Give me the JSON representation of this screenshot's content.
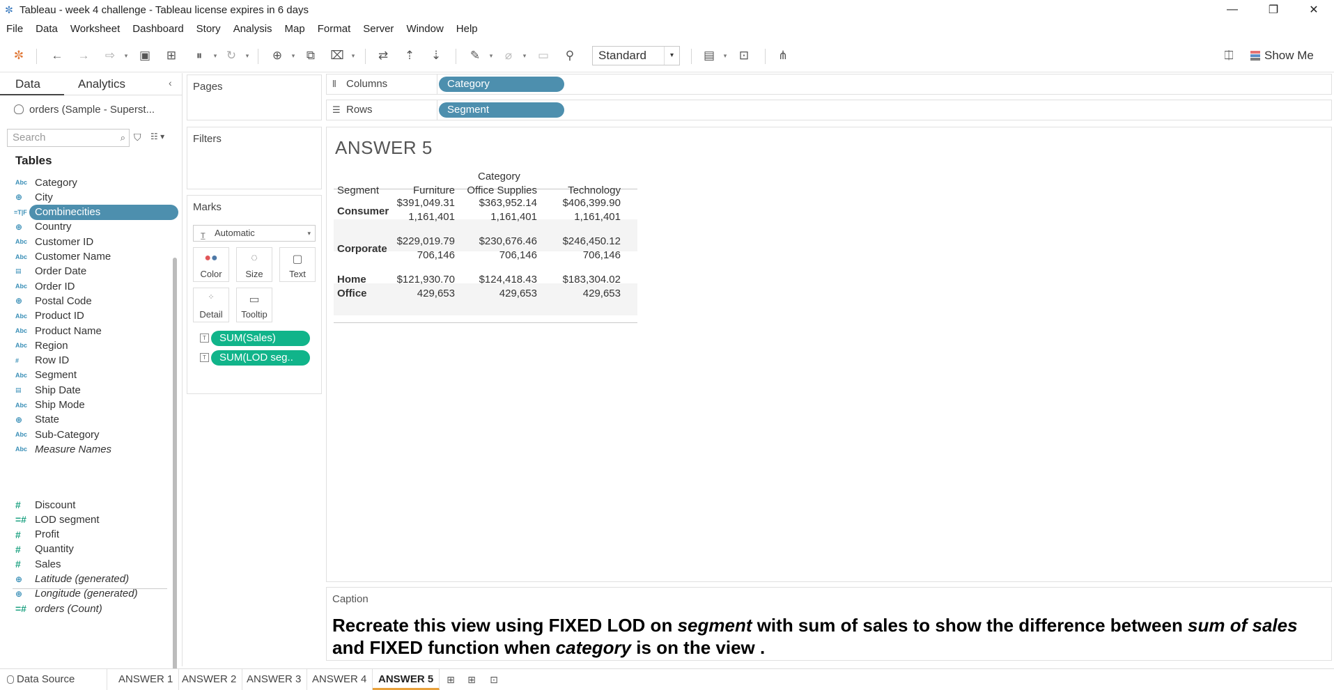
{
  "window": {
    "title": "Tableau - week 4 challenge - Tableau license expires in 6 days",
    "minimize": "—",
    "restore": "❐",
    "close": "✕"
  },
  "menu": [
    "File",
    "Data",
    "Worksheet",
    "Dashboard",
    "Story",
    "Analysis",
    "Map",
    "Format",
    "Server",
    "Window",
    "Help"
  ],
  "toolbar": {
    "fit_value": "Standard",
    "show_me_label": "Show Me"
  },
  "data_pane": {
    "tab_data": "Data",
    "tab_analytics": "Analytics",
    "datasource": "orders (Sample - Superst...",
    "search_placeholder": "Search",
    "tables_heading": "Tables",
    "dimensions": [
      {
        "name": "Category",
        "icon": "Abc"
      },
      {
        "name": "City",
        "icon": "geo"
      },
      {
        "name": "Combinecities",
        "icon": "combo",
        "selected": true
      },
      {
        "name": "Country",
        "icon": "geo"
      },
      {
        "name": "Customer ID",
        "icon": "Abc"
      },
      {
        "name": "Customer Name",
        "icon": "Abc"
      },
      {
        "name": "Order Date",
        "icon": "date"
      },
      {
        "name": "Order ID",
        "icon": "Abc"
      },
      {
        "name": "Postal Code",
        "icon": "geo"
      },
      {
        "name": "Product ID",
        "icon": "Abc"
      },
      {
        "name": "Product Name",
        "icon": "Abc"
      },
      {
        "name": "Region",
        "icon": "Abc"
      },
      {
        "name": "Row ID",
        "icon": "#"
      },
      {
        "name": "Segment",
        "icon": "Abc"
      },
      {
        "name": "Ship Date",
        "icon": "date"
      },
      {
        "name": "Ship Mode",
        "icon": "Abc"
      },
      {
        "name": "State",
        "icon": "geo"
      },
      {
        "name": "Sub-Category",
        "icon": "Abc"
      },
      {
        "name": "Measure Names",
        "icon": "Abc",
        "italic": true
      }
    ],
    "measures": [
      {
        "name": "Discount",
        "icon": "#"
      },
      {
        "name": "LOD segment",
        "icon": "=#"
      },
      {
        "name": "Profit",
        "icon": "#"
      },
      {
        "name": "Quantity",
        "icon": "#"
      },
      {
        "name": "Sales",
        "icon": "#"
      },
      {
        "name": "Latitude (generated)",
        "icon": "geo",
        "italic": true
      },
      {
        "name": "Longitude (generated)",
        "icon": "geo",
        "italic": true
      },
      {
        "name": "orders (Count)",
        "icon": "=#",
        "italic": true
      }
    ]
  },
  "cards": {
    "pages": "Pages",
    "filters": "Filters",
    "marks": "Marks",
    "mark_type": "Automatic",
    "mark_buttons": [
      "Color",
      "Size",
      "Text",
      "Detail",
      "Tooltip"
    ],
    "mark_pills": [
      "SUM(Sales)",
      "SUM(LOD seg.."
    ]
  },
  "shelves": {
    "columns_label": "Columns",
    "columns_pill": "Category",
    "rows_label": "Rows",
    "rows_pill": "Segment"
  },
  "view": {
    "sheet_title": "ANSWER 5",
    "column_group_header": "Category",
    "row_header": "Segment",
    "columns": [
      "Furniture",
      "Office Supplies",
      "Technology"
    ],
    "rows": [
      {
        "segment": "Consumer",
        "sales": [
          "$391,049.31",
          "$363,952.14",
          "$406,399.90"
        ],
        "lod": [
          "1,161,401",
          "1,161,401",
          "1,161,401"
        ]
      },
      {
        "segment": "Corporate",
        "sales": [
          "$229,019.79",
          "$230,676.46",
          "$246,450.12"
        ],
        "lod": [
          "706,146",
          "706,146",
          "706,146"
        ]
      },
      {
        "segment": "Home Office",
        "segment_line1": "Home",
        "segment_line2": "Office",
        "sales": [
          "$121,930.70",
          "$124,418.43",
          "$183,304.02"
        ],
        "lod": [
          "429,653",
          "429,653",
          "429,653"
        ]
      }
    ]
  },
  "caption": {
    "label": "Caption",
    "part1": "Recreate this view using FIXED LOD on ",
    "em1": "segment",
    "part2": " with sum of sales to show the difference between ",
    "em2": "sum of sales",
    "part3": " and FIXED function when ",
    "em3": "category",
    "part4": " is on the view ."
  },
  "sheet_tabs": {
    "data_source": "Data Source",
    "sheets": [
      "ANSWER 1",
      "ANSWER 2",
      "ANSWER 3",
      "ANSWER 4",
      "ANSWER 5"
    ],
    "active": "ANSWER 5"
  }
}
